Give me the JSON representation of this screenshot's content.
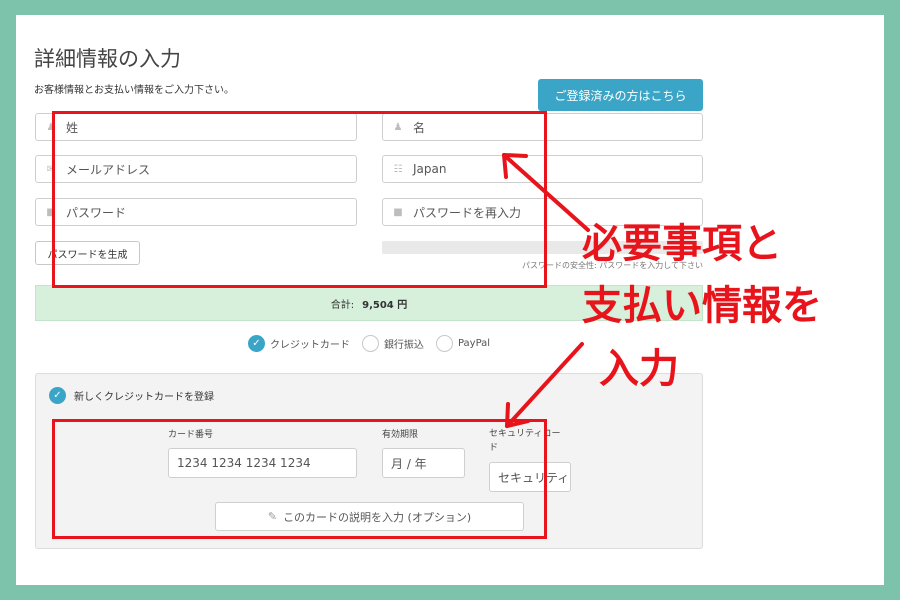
{
  "header": {
    "title": "詳細情報の入力",
    "subtitle": "お客様情報とお支払い情報をご入力下さい。",
    "login_button": "ご登録済みの方はこちら"
  },
  "form": {
    "last_name": "姓",
    "first_name": "名",
    "email": "メールアドレス",
    "country": "Japan",
    "password": "パスワード",
    "password_confirm": "パスワードを再入力",
    "generate_button": "パスワードを生成",
    "strength_text": "パスワードの安全性: パスワードを入力して下さい"
  },
  "total": {
    "label": "合計:",
    "amount": "9,504 円"
  },
  "payment_methods": [
    {
      "label": "クレジットカード",
      "selected": true
    },
    {
      "label": "銀行振込",
      "selected": false
    },
    {
      "label": "PayPal",
      "selected": false
    }
  ],
  "card": {
    "new_card_label": "新しくクレジットカードを登録",
    "number_label": "カード番号",
    "number_placeholder": "1234 1234 1234 1234",
    "expiry_label": "有効期限",
    "expiry_placeholder": "月 / 年",
    "cvc_label": "セキュリティコード",
    "cvc_placeholder": "セキュリティ",
    "description_placeholder": "このカードの説明を入力 (オプション)"
  },
  "annotation": {
    "line1": "必要事項と",
    "line2": "支払い情報を",
    "line3": "入力"
  },
  "colors": {
    "background": "#7dc3ac",
    "accent": "#3aa5c6",
    "annotation_red": "#e8141b",
    "total_bg": "#d6f0dc"
  }
}
